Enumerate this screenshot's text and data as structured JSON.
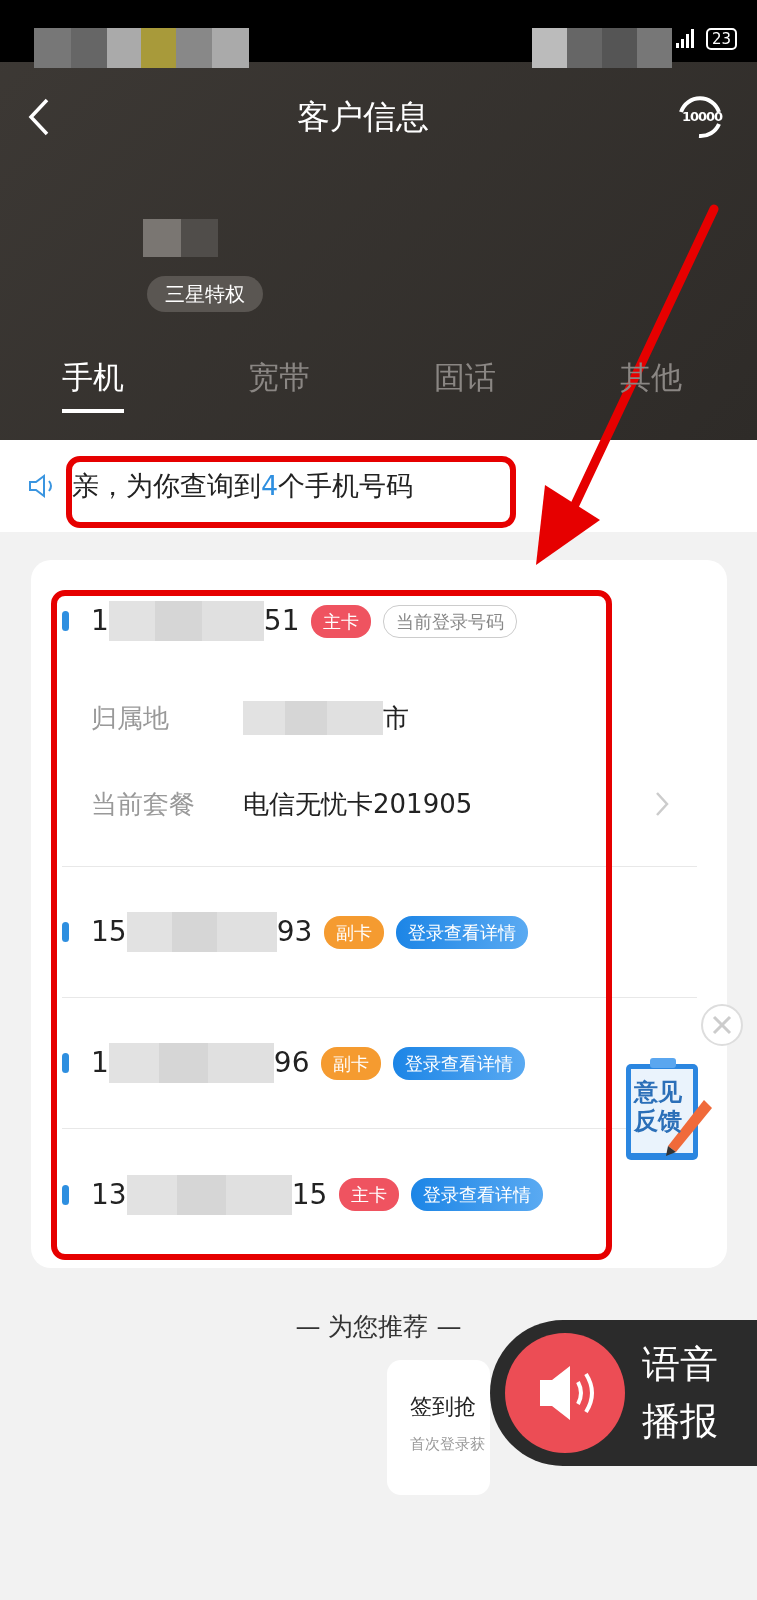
{
  "status_bar": {
    "battery": "23"
  },
  "header": {
    "title": "客户信息",
    "hotline": "10000",
    "badge": "三星特权"
  },
  "tabs": [
    {
      "label": "手机",
      "selected": true
    },
    {
      "label": "宽带",
      "selected": false
    },
    {
      "label": "固话",
      "selected": false
    },
    {
      "label": "其他",
      "selected": false
    }
  ],
  "notice": {
    "before": "亲，为你查询到",
    "count": "4",
    "after": "个手机号码"
  },
  "numbers": [
    {
      "prefix": "1",
      "suffix": "51",
      "card_type": {
        "text": "主卡",
        "color": "#ef5360"
      },
      "tag": {
        "kind": "outline",
        "text": "当前登录号码"
      },
      "details": [
        {
          "label": "归属地",
          "value_suffix": "市"
        },
        {
          "label": "当前套餐",
          "value": "电信无忧卡201905"
        }
      ]
    },
    {
      "prefix": "15",
      "suffix": "93",
      "card_type": {
        "text": "副卡",
        "color": "#f59b30"
      },
      "tag": {
        "kind": "action",
        "text": "登录查看详情"
      }
    },
    {
      "prefix": "1",
      "suffix": "96",
      "card_type": {
        "text": "副卡",
        "color": "#f59b30"
      },
      "tag": {
        "kind": "action",
        "text": "登录查看详情"
      }
    },
    {
      "prefix": "13",
      "suffix": "15",
      "card_type": {
        "text": "主卡",
        "color": "#ef5360"
      },
      "tag": {
        "kind": "action",
        "text": "登录查看详情"
      }
    }
  ],
  "feedback": {
    "label": "意见反馈"
  },
  "recommend": {
    "heading": "— 为您推荐 —",
    "card": {
      "title": "签到抢",
      "subtitle": "首次登录获"
    }
  },
  "voice_button": {
    "label": "语音播报"
  }
}
